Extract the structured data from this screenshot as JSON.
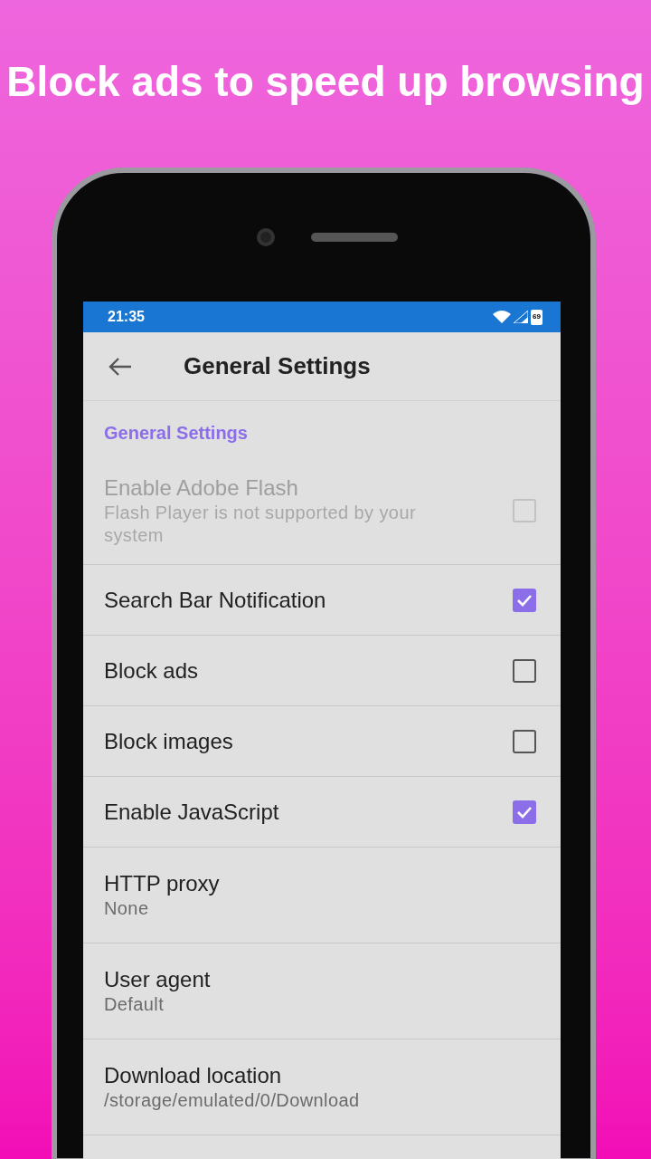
{
  "headline": "Block ads to speed up browsing",
  "status_bar": {
    "time": "21:35",
    "battery": "69"
  },
  "app_bar": {
    "title": "General Settings"
  },
  "category": "General Settings",
  "items": [
    {
      "kind": "checkbox",
      "title": "Enable Adobe Flash",
      "summary": "Flash Player is not supported by your system",
      "checked": false,
      "disabled": true
    },
    {
      "kind": "checkbox",
      "title": "Search Bar Notification",
      "checked": true,
      "disabled": false
    },
    {
      "kind": "checkbox",
      "title": "Block ads",
      "checked": false,
      "disabled": false
    },
    {
      "kind": "checkbox",
      "title": "Block images",
      "checked": false,
      "disabled": false
    },
    {
      "kind": "checkbox",
      "title": "Enable JavaScript",
      "checked": true,
      "disabled": false
    },
    {
      "kind": "value",
      "title": "HTTP proxy",
      "summary": "None"
    },
    {
      "kind": "value",
      "title": "User agent",
      "summary": "Default"
    },
    {
      "kind": "value",
      "title": "Download location",
      "summary": "/storage/emulated/0/Download"
    }
  ]
}
